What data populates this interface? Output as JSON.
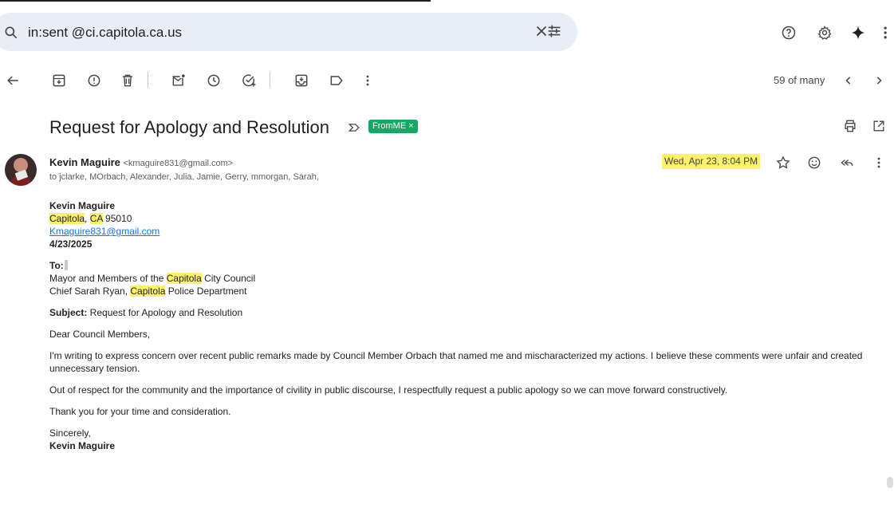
{
  "search": {
    "query": "in:sent @ci.capitola.ca.us"
  },
  "toolbar": {
    "pager": "59 of many"
  },
  "email": {
    "subject": "Request for Apology and Resolution",
    "label": "FromME ×",
    "sender_name": "Kevin Maguire",
    "sender_email": "<kmaguire831@gmail.com>",
    "recipients": "to jclarke, MOrbach, Alexander, Julia, Jamie, Gerry, mmorgan, Sarah,",
    "date": "Wed, Apr 23, 8:04 PM"
  },
  "body": {
    "sig_name": "Kevin Maguire",
    "city": "Capitola",
    "city_sep": ", ",
    "state": "CA",
    "zip": " 95010",
    "email_link": "Kmaguire831@gmail.com",
    "date": "4/23/2025",
    "to_label": "To:",
    "to_line1_a": "Mayor and Members of the ",
    "to_line1_hl": "Capitola",
    "to_line1_b": " City Council",
    "to_line2_a": "Chief Sarah Ryan, ",
    "to_line2_hl": "Capitola",
    "to_line2_b": " Police Department",
    "subject_label": "Subject:",
    "subject_value": " Request for Apology and Resolution",
    "greeting": "Dear Council Members,",
    "para1": "I'm writing to express concern over recent public remarks made by Council Member Orbach that named me and mischaracterized my actions. I believe these comments were unfair and created unnecessary tension.",
    "para2": "Out of respect for the community and the importance of civility in public discourse, I respectfully request a public apology so we can move forward constructively.",
    "para3": "Thank you for your time and consideration.",
    "closing": "Sincerely,",
    "closing_name": "Kevin Maguire"
  },
  "colors": {
    "search_bg": "#e9eef6",
    "highlight": "#fdf16b",
    "label_green": "#16a765",
    "link": "#1a73e8"
  }
}
